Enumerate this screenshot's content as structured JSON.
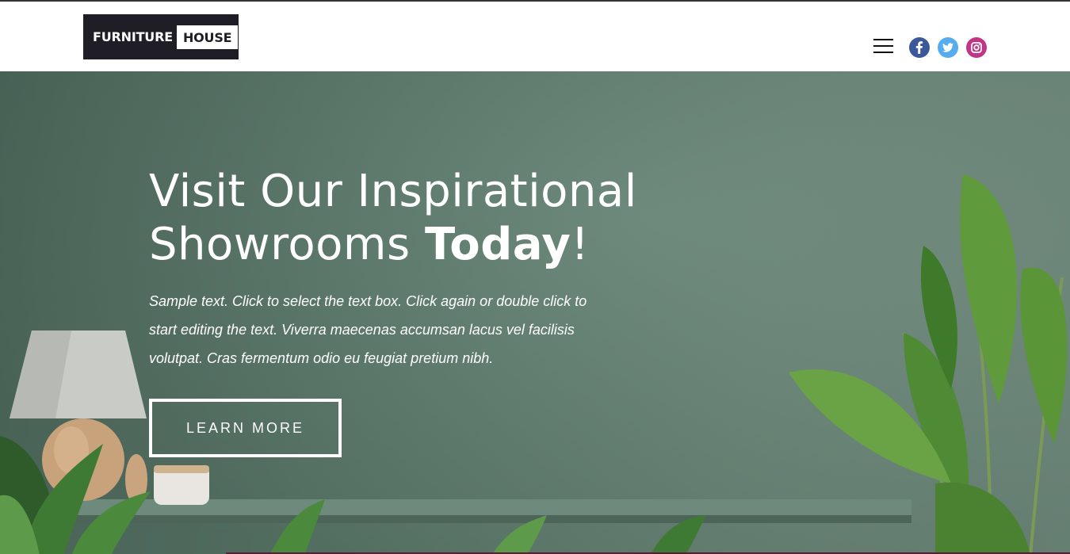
{
  "header": {
    "logo": {
      "left": "FURNITURE",
      "right": "HOUSE"
    },
    "menu_icon": "hamburger-menu-icon",
    "social": [
      {
        "name": "facebook-icon",
        "color": "#3b5998"
      },
      {
        "name": "twitter-icon",
        "color": "#55acee"
      },
      {
        "name": "instagram-icon",
        "color": "#c13584"
      }
    ]
  },
  "hero": {
    "title_line1": "Visit Our Inspirational",
    "title_line2_regular": "Showrooms ",
    "title_line2_bold": "Today",
    "title_line2_end": "!",
    "body": "Sample text. Click to select the text box. Click again or double click to start editing the text. Viverra maecenas accumsan lacus vel facilisis volutpat. Cras fermentum odio eu feugiat pretium nibh.",
    "button_label": "LEARN MORE",
    "background_color": "#5b7a6b"
  }
}
